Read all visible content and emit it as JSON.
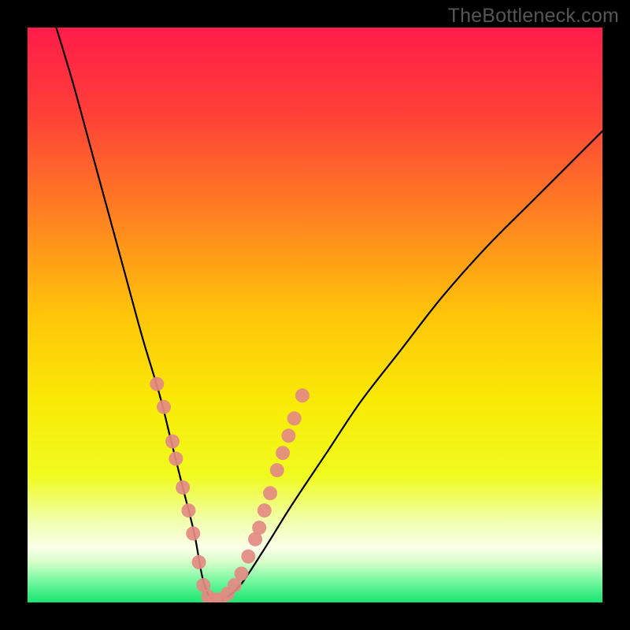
{
  "watermark": "TheBottleneck.com",
  "chart_data": {
    "type": "line",
    "title": "",
    "xlabel": "",
    "ylabel": "",
    "xlim": [
      0,
      100
    ],
    "ylim": [
      0,
      100
    ],
    "note": "Curve values estimated from pixel positions; x is normalized horizontal position (0-100), y is percentage height from bottom (0-100).",
    "series": [
      {
        "name": "bottleneck-curve",
        "x": [
          5,
          8,
          11,
          14,
          17,
          20,
          23,
          25,
          27,
          29,
          30.5,
          32,
          34,
          37,
          41,
          46,
          52,
          58,
          65,
          72,
          80,
          88,
          96,
          100
        ],
        "values": [
          100,
          90,
          79,
          68,
          57,
          46,
          36,
          28,
          20,
          12,
          4,
          0.5,
          0.5,
          3,
          9,
          17,
          26,
          35,
          44,
          53,
          62,
          70,
          78,
          82
        ]
      }
    ],
    "highlighted_points": {
      "name": "pink-dots",
      "comment": "Clusters of salmon/pink markers along the curve near the valley",
      "points": [
        {
          "x": 22.5,
          "y": 38
        },
        {
          "x": 23.7,
          "y": 34
        },
        {
          "x": 25.2,
          "y": 28
        },
        {
          "x": 25.8,
          "y": 25
        },
        {
          "x": 27.0,
          "y": 20
        },
        {
          "x": 28.0,
          "y": 16
        },
        {
          "x": 28.8,
          "y": 12
        },
        {
          "x": 29.8,
          "y": 7
        },
        {
          "x": 30.6,
          "y": 3
        },
        {
          "x": 31.4,
          "y": 1
        },
        {
          "x": 32.5,
          "y": 0.5
        },
        {
          "x": 33.6,
          "y": 0.5
        },
        {
          "x": 34.8,
          "y": 1.5
        },
        {
          "x": 36.0,
          "y": 3
        },
        {
          "x": 37.2,
          "y": 5
        },
        {
          "x": 38.4,
          "y": 8
        },
        {
          "x": 39.6,
          "y": 11
        },
        {
          "x": 40.3,
          "y": 13
        },
        {
          "x": 41.2,
          "y": 16
        },
        {
          "x": 42.2,
          "y": 19
        },
        {
          "x": 43.4,
          "y": 23
        },
        {
          "x": 44.4,
          "y": 26
        },
        {
          "x": 45.4,
          "y": 29
        },
        {
          "x": 46.4,
          "y": 32
        },
        {
          "x": 47.8,
          "y": 36
        }
      ]
    },
    "background_gradient": {
      "type": "vertical",
      "stops": [
        {
          "pos": 0.0,
          "color": "#ff1c49"
        },
        {
          "pos": 0.15,
          "color": "#ff4038"
        },
        {
          "pos": 0.35,
          "color": "#ff8a1e"
        },
        {
          "pos": 0.5,
          "color": "#ffc509"
        },
        {
          "pos": 0.65,
          "color": "#f9ea06"
        },
        {
          "pos": 0.78,
          "color": "#f0fb1f"
        },
        {
          "pos": 0.86,
          "color": "#f0ffb0"
        },
        {
          "pos": 0.905,
          "color": "#fbffe8"
        },
        {
          "pos": 0.93,
          "color": "#d6ffc9"
        },
        {
          "pos": 0.96,
          "color": "#7cf9a2"
        },
        {
          "pos": 1.0,
          "color": "#18e56f"
        }
      ]
    }
  }
}
